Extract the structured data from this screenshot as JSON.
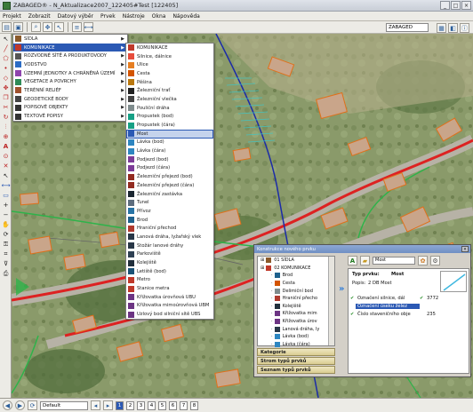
{
  "window": {
    "title": "ZABAGED® - N_Aktualizace2007_122405#Test [122405]"
  },
  "menubar": [
    "Projekt",
    "Zobrazit",
    "Datový výběr",
    "Prvek",
    "Nástroje",
    "Okna",
    "Nápověda"
  ],
  "toolbar": {
    "layer_label": "ZABAGED"
  },
  "menu1": {
    "items": [
      {
        "label": "SÍDLA",
        "icon": "building-icon",
        "color": "#8a5a2b"
      },
      {
        "label": "KOMUNIKACE",
        "icon": "road-icon",
        "color": "#c0392b"
      },
      {
        "label": "ROZVODNÉ SÍTĚ A PRODUKTOVODY",
        "icon": "power-line-icon",
        "color": "#555555"
      },
      {
        "label": "VODSTVO",
        "icon": "water-icon",
        "color": "#2b6cc4"
      },
      {
        "label": "ÚZEMNÍ JEDNOTKY A CHRÁNĚNÁ ÚZEMÍ",
        "icon": "territory-icon",
        "color": "#8e44ad"
      },
      {
        "label": "VEGETACE A POVRCHY",
        "icon": "tree-icon",
        "color": "#2e8b57"
      },
      {
        "label": "TERÉNNÍ RELIÉF",
        "icon": "relief-icon",
        "color": "#a0522d"
      },
      {
        "label": "GEODETICKÉ BODY",
        "icon": "survey-point-icon",
        "color": "#444444"
      },
      {
        "label": "POPISOVÉ OBJEKTY",
        "icon": "text-object-icon",
        "color": "#333333"
      },
      {
        "label": "TEXTOVÉ POPISY",
        "icon": "text-label-icon",
        "color": "#333333"
      }
    ]
  },
  "menu2": {
    "items": [
      {
        "label": "KOMUNIKACE",
        "color": "#c0392b"
      },
      {
        "label": "Silnice, dálnice",
        "color": "#e74c3c"
      },
      {
        "label": "Ulice",
        "color": "#e67e22"
      },
      {
        "label": "Cesta",
        "color": "#d35400"
      },
      {
        "label": "Pěšina",
        "color": "#b9770e"
      },
      {
        "label": "Železniční trať",
        "color": "#222222"
      },
      {
        "label": "Železniční vlečka",
        "color": "#444444"
      },
      {
        "label": "Pouliční dráha",
        "color": "#7f8c8d"
      },
      {
        "label": "Propustek (bod)",
        "color": "#16a085"
      },
      {
        "label": "Propustek (čára)",
        "color": "#16a085"
      },
      {
        "label": "Most",
        "color": "#2b59b4"
      },
      {
        "label": "Lávka (bod)",
        "color": "#2e86c1"
      },
      {
        "label": "Lávka (čára)",
        "color": "#2e86c1"
      },
      {
        "label": "Podjezd (bod)",
        "color": "#7d3c98"
      },
      {
        "label": "Podjezd (čára)",
        "color": "#7d3c98"
      },
      {
        "label": "Železniční přejezd (bod)",
        "color": "#922b21"
      },
      {
        "label": "Železniční přejezd (čára)",
        "color": "#922b21"
      },
      {
        "label": "Železniční zastávka",
        "color": "#1b2631"
      },
      {
        "label": "Tunel",
        "color": "#5d6d7e"
      },
      {
        "label": "Přívoz",
        "color": "#2874a6"
      },
      {
        "label": "Brod",
        "color": "#1f618d"
      },
      {
        "label": "Hraniční přechod",
        "color": "#b03a2e"
      },
      {
        "label": "Lanová dráha, lyžařský vlek",
        "color": "#283747"
      },
      {
        "label": "Stožár lanové dráhy",
        "color": "#283747"
      },
      {
        "label": "Parkoviště",
        "color": "#2e4053"
      },
      {
        "label": "Kolejiště",
        "color": "#212f3c"
      },
      {
        "label": "Letiště (bod)",
        "color": "#1a5276"
      },
      {
        "label": "Metro",
        "color": "#c0392b"
      },
      {
        "label": "Stanice metra",
        "color": "#c0392b"
      },
      {
        "label": "Křižovatka úrovňová UBU",
        "color": "#6c3483"
      },
      {
        "label": "Křižovatka mimoúrovňová UBM",
        "color": "#6c3483"
      },
      {
        "label": "Uzlový bod silniční sítě UBS",
        "color": "#6c3483"
      }
    ]
  },
  "dialog": {
    "title": "Konstrukce nového prvku",
    "tree": [
      {
        "label": "01 SÍDLA",
        "color": "#8a5a2b",
        "indent": 0
      },
      {
        "label": "02 KOMUNIKACE",
        "color": "#c0392b",
        "indent": 0
      },
      {
        "label": "Brod",
        "color": "#1f618d",
        "indent": 1
      },
      {
        "label": "Cesta",
        "color": "#d35400",
        "indent": 1
      },
      {
        "label": "Delimiční bod",
        "color": "#7f8c8d",
        "indent": 1
      },
      {
        "label": "Hraniční přecho",
        "color": "#b03a2e",
        "indent": 1
      },
      {
        "label": "Kolejiště",
        "color": "#212f3c",
        "indent": 1
      },
      {
        "label": "Křižovatka mim",
        "color": "#6c3483",
        "indent": 1
      },
      {
        "label": "Křižovatka úrov",
        "color": "#6c3483",
        "indent": 1
      },
      {
        "label": "Lanová dráha, ly",
        "color": "#283747",
        "indent": 1
      },
      {
        "label": "Lávka (bod)",
        "color": "#2e86c1",
        "indent": 1
      },
      {
        "label": "Lávka (čára)",
        "color": "#2e86c1",
        "indent": 1
      }
    ],
    "panels": [
      "Kategorie",
      "Strom typů prvků",
      "Seznam typů prvků"
    ],
    "prvek_select": "Most",
    "type_label": "Typ prvku:",
    "type_value": "Most",
    "popis_label": "Popis:",
    "popis_value": "2 DB Most",
    "attributes": [
      {
        "name": "Označení silnice, dál",
        "value": "3772"
      },
      {
        "name": "Označení úseku želez",
        "value": ""
      },
      {
        "name": "Číslo staveničního obje",
        "value": "235"
      }
    ]
  },
  "statusbar": {
    "style": "Default",
    "pages": [
      "1",
      "2",
      "3",
      "4",
      "5",
      "6",
      "7",
      "8"
    ]
  }
}
